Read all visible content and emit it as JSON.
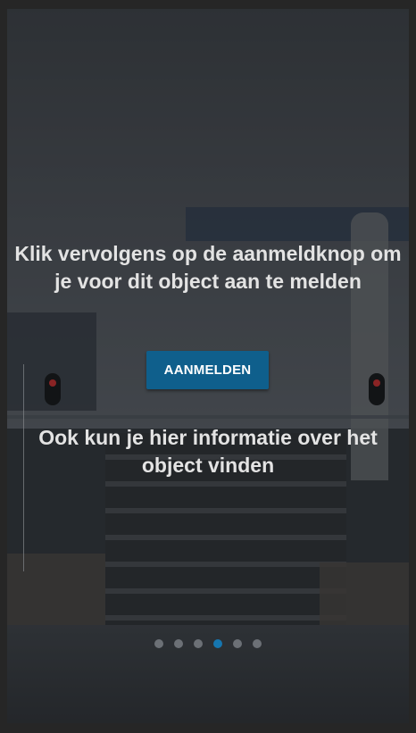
{
  "slide": {
    "text_top": "Klik vervolgens op de aanmeldknop om je voor dit object aan te melden",
    "button_label": "AANMELDEN",
    "text_bottom": "Ook kun je hier informatie over het object vinden"
  },
  "pagination": {
    "count": 6,
    "active_index": 3
  },
  "colors": {
    "button": "#0f5f8c",
    "active_dot": "#1676b0",
    "inactive_dot": "#6c7076",
    "text": "#e3e3e3"
  }
}
